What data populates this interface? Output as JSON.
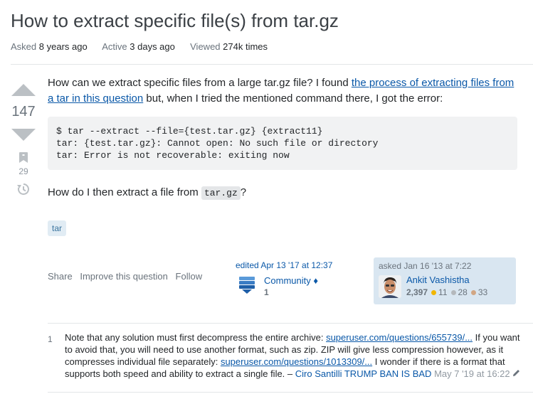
{
  "question": {
    "title": "How to extract specific file(s) from tar.gz",
    "meta": {
      "asked_label": "Asked",
      "asked_value": "8 years ago",
      "active_label": "Active",
      "active_value": "3 days ago",
      "viewed_label": "Viewed",
      "viewed_value": "274k times"
    },
    "score": "147",
    "bookmark_count": "29",
    "body": {
      "p1_before": "How can we extract specific files from a large tar.gz file? I found ",
      "p1_link": "the process of extracting files from a tar in this question",
      "p1_after": " but, when I tried the mentioned command there, I got the error:",
      "code": "$ tar --extract --file={test.tar.gz} {extract11}\ntar: {test.tar.gz}: Cannot open: No such file or directory\ntar: Error is not recoverable: exiting now",
      "p2_before": "How do I then extract a file from ",
      "p2_code": "tar.gz",
      "p2_after": "?"
    },
    "tags": [
      "tar"
    ],
    "actions": {
      "share": "Share",
      "improve": "Improve this question",
      "follow": "Follow"
    },
    "edited": {
      "label": "edited Apr 13 '17 at 12:37",
      "user": "Community",
      "user_badge": "♦",
      "rep": "1"
    },
    "asked": {
      "label": "asked Jan 16 '13 at 7:22",
      "user": "Ankit Vashistha",
      "rep": "2,397",
      "gold": "11",
      "silver": "28",
      "bronze": "33"
    }
  },
  "comments": [
    {
      "score": "1",
      "text1": "Note that any solution must first decompress the entire archive: ",
      "link1": "superuser.com/questions/655739/...",
      "text2": " If you want to avoid that, you will need to use another format, such as zip. ZIP will give less compression however, as it compresses individual file separately: ",
      "link2": "superuser.com/questions/1013309/...",
      "text3": " I wonder if there is a format that supports both speed and ability to extract a single file. – ",
      "author": "Ciro Santilli TRUMP BAN IS BAD",
      "date": "May 7 '19 at 16:22"
    }
  ],
  "colors": {
    "link": "#0a58a8",
    "tag_bg": "#e1ecf4",
    "tag_text": "#39739d",
    "owner_bg": "#d9e6f1",
    "gold": "#f1b600",
    "silver": "#b4b8bc",
    "bronze": "#d1a684"
  }
}
